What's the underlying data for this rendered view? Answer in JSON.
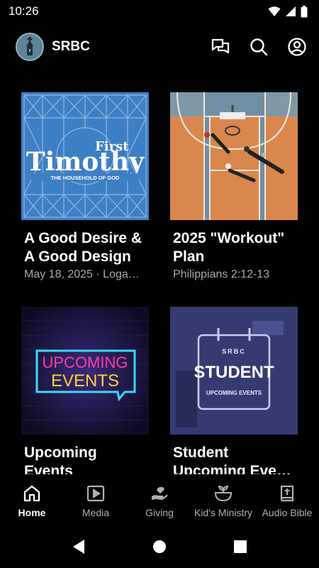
{
  "status_bar": {
    "time": "10:26"
  },
  "header": {
    "title": "SRBC"
  },
  "cards": [
    {
      "title": "A Good Desire &\nA Good Design",
      "subtitle": "May 18, 2025 · Loga…",
      "thumb_text_top": "First",
      "thumb_text_main": "Timothy",
      "thumb_text_sub": "THE HOUSEHOLD OF GOD"
    },
    {
      "title": "2025 \"Workout\"\nPlan",
      "subtitle": "Philippians 2:12-13"
    },
    {
      "title": "Upcoming\nEvents",
      "subtitle": "",
      "thumb_text_line1": "UPCOMING",
      "thumb_text_line2": "EVENTS"
    },
    {
      "title": "Student\nUpcoming Eve…",
      "subtitle": "",
      "thumb_text_top": "SRBC",
      "thumb_text_main": "STUDENT",
      "thumb_text_sub": "UPCOMING EVENTS"
    }
  ],
  "bottom_nav": [
    {
      "label": "Home",
      "icon": "home-icon",
      "active": true
    },
    {
      "label": "Media",
      "icon": "media-play-icon"
    },
    {
      "label": "Giving",
      "icon": "giving-hand-icon"
    },
    {
      "label": "Kid's Ministry",
      "icon": "kids-ministry-icon"
    },
    {
      "label": "Audio Bible",
      "icon": "bible-icon"
    }
  ],
  "colors": {
    "background": "#000000",
    "accent": "#ffffff",
    "muted_text": "#a8a8a8"
  }
}
